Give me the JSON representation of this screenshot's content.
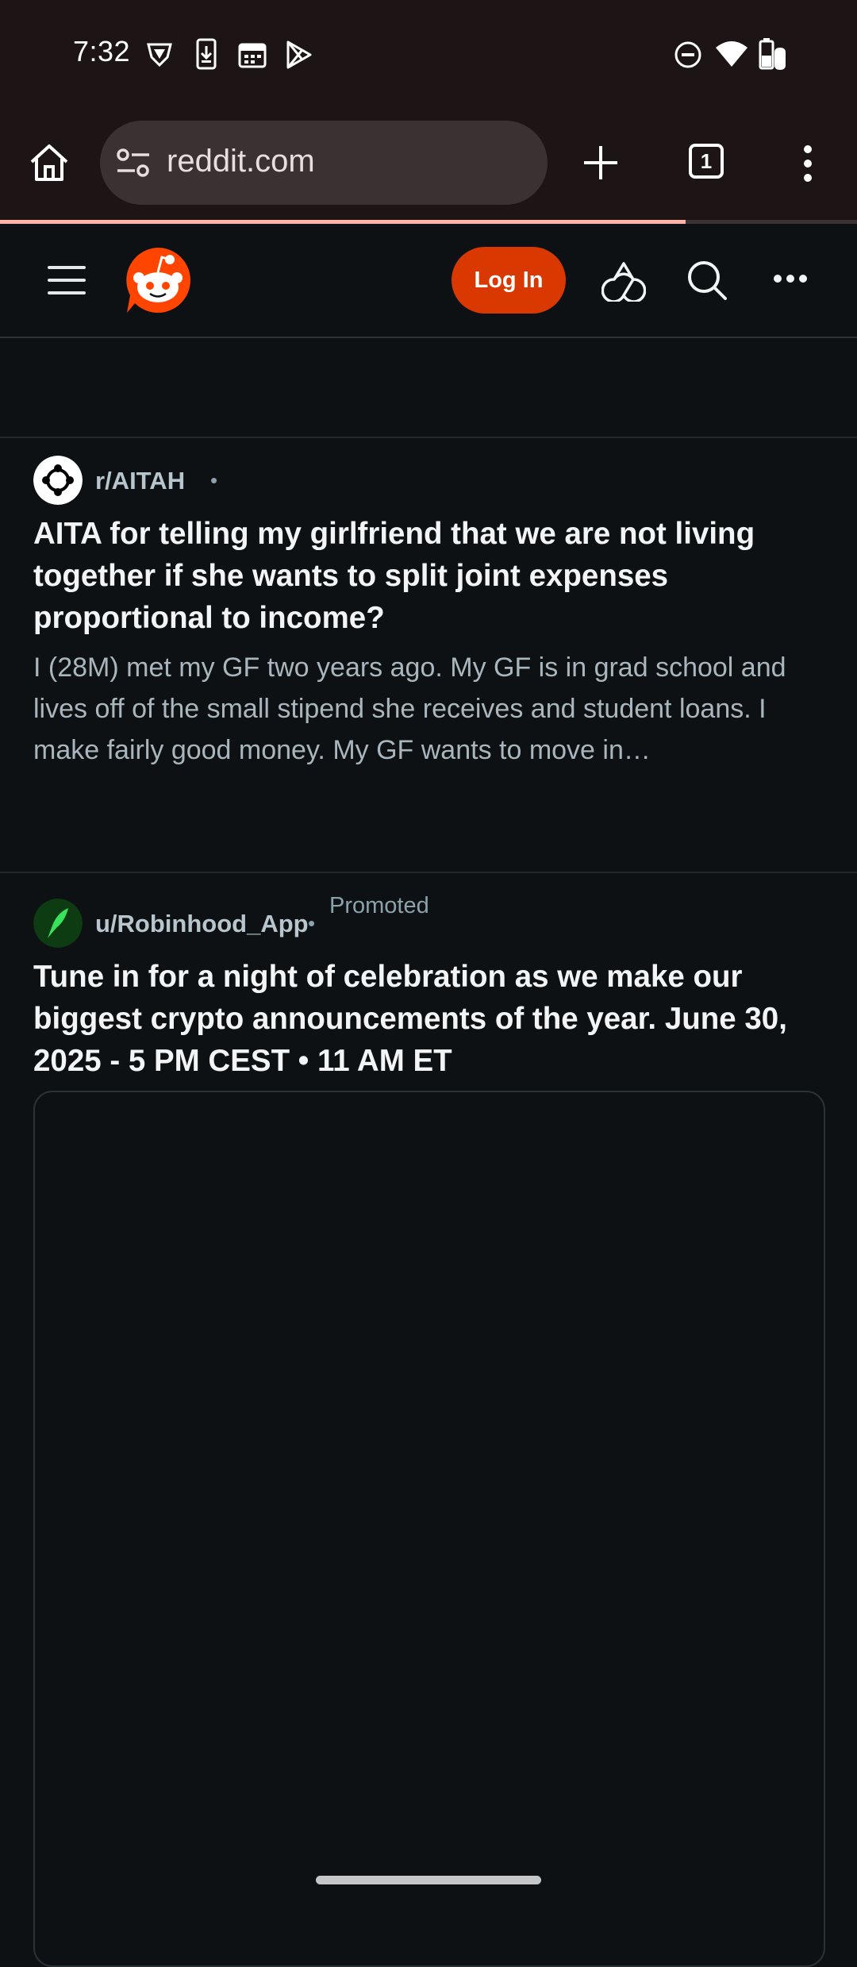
{
  "status_bar": {
    "time": "7:32",
    "left_icons": [
      "vpn-shield-icon",
      "phone-download-icon",
      "calendar-icon",
      "play-store-icon"
    ],
    "right_icons": [
      "do-not-disturb-icon",
      "wifi-icon",
      "battery-icon"
    ]
  },
  "browser": {
    "url": "reddit.com",
    "tab_count": "1",
    "page_load_progress_percent": 80
  },
  "reddit_header": {
    "login_label": "Log In"
  },
  "feed": {
    "posts": [
      {
        "community": "r/AITAH",
        "separator": "•",
        "title": "AITA for telling my girlfriend that we are not living together if she wants to split joint expenses proportional to income?",
        "body": "I (28M) met my GF two years ago. My GF is in grad school and lives off of the small stipend she receives and student loans. I make fairly good money. My GF wants to move in…"
      },
      {
        "community": "u/Robinhood_App",
        "separator": "•",
        "badge": "Promoted",
        "title": "Tune in for a night of celebration as we make our biggest crypto announcements of the year. June 30, 2025 - 5 PM CEST • 11 AM ET"
      }
    ]
  },
  "colors": {
    "chrome_bar": "#1d1415",
    "page_bg": "#0e1113",
    "login_button": "#d93900",
    "reddit_orange": "#ff4500",
    "progress": "#ffb4a6"
  }
}
